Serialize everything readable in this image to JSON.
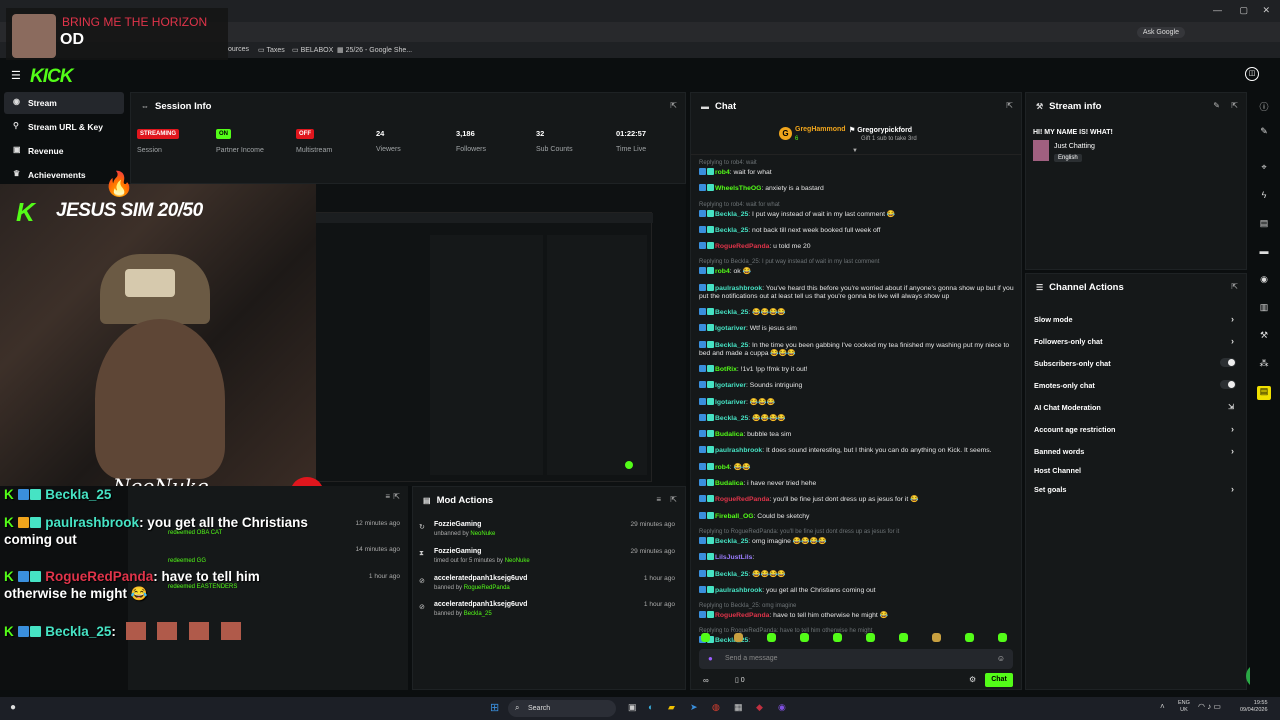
{
  "browser": {
    "song_title": "BRING ME THE HORIZON",
    "song_sub": "OD",
    "bookmarks": [
      "ources",
      "Taxes",
      "BELABOX",
      "25/26 - Google She..."
    ],
    "ask_google": "Ask Google"
  },
  "sidebar": {
    "items": [
      {
        "label": "Stream",
        "icon": "broadcast-icon"
      },
      {
        "label": "Stream URL & Key",
        "icon": "key-icon"
      },
      {
        "label": "Revenue",
        "icon": "dollar-icon"
      },
      {
        "label": "Achievements",
        "icon": "trophy-icon"
      }
    ]
  },
  "session": {
    "title": "Session Info",
    "stats": [
      {
        "value": "STREAMING",
        "label": "Session",
        "kind": "badge",
        "color": "#e0161d"
      },
      {
        "value": "ON",
        "label": "Partner Income",
        "kind": "badge",
        "color": "#53fc18"
      },
      {
        "value": "OFF",
        "label": "Multistream",
        "kind": "badge",
        "color": "#e0161d"
      },
      {
        "value": "24",
        "label": "Viewers",
        "kind": "text"
      },
      {
        "value": "3,186",
        "label": "Followers",
        "kind": "text"
      },
      {
        "value": "32",
        "label": "Sub Counts",
        "kind": "text"
      },
      {
        "value": "01:22:57",
        "label": "Time Live",
        "kind": "text"
      }
    ]
  },
  "overlay": {
    "goal": "JESUS SIM 20/50",
    "signature": "NeoNuke",
    "chat": [
      {
        "user": "Beckla_25",
        "user_color": "#46e3c4",
        "text": ""
      },
      {
        "user": "paulrashbrook",
        "user_color": "#46e3c4",
        "text": ": you get all the Christians coming out"
      },
      {
        "user": "RogueRedPanda",
        "user_color": "#e0344a",
        "text": ": have to tell him otherwise he might 😂"
      },
      {
        "user": "Beckla_25",
        "user_color": "#46e3c4",
        "text": ":"
      }
    ],
    "redeems": [
      {
        "text": "redeemed OBA CAT",
        "time": "12 minutes ago"
      },
      {
        "text": "redeemed GG",
        "time": "14 minutes ago"
      },
      {
        "text": "redeemed EASTENDERS",
        "time": "1 hour ago"
      }
    ]
  },
  "mod_actions": {
    "title": "Mod Actions",
    "items": [
      {
        "user": "FozzieGaming",
        "detail_prefix": "unbanned by ",
        "by": "NeoNuke",
        "time": "29 minutes ago",
        "icon": "unban-icon"
      },
      {
        "user": "FozzieGaming",
        "detail_prefix": "timed out for 5 minutes by ",
        "by": "NeoNuke",
        "time": "29 minutes ago",
        "icon": "hourglass-icon"
      },
      {
        "user": "acceleratedpanh1ksejg6uvd",
        "detail_prefix": "banned by ",
        "by": "RogueRedPanda",
        "time": "1 hour ago",
        "icon": "ban-icon"
      },
      {
        "user": "acceleratedpanh1ksejg6uvd",
        "detail_prefix": "banned by ",
        "by": "Beckla_25",
        "time": "1 hour ago",
        "icon": "ban-icon"
      }
    ]
  },
  "chat": {
    "title": "Chat",
    "pinned_gifter": "GregHammond",
    "pinned_gifter_sub": "6",
    "pinned_gift_to": "Gregorypickford",
    "pinned_note": "Gift 1 sub to take 3rd",
    "messages": [
      {
        "user": "rob4",
        "color": "#53fc18",
        "text": ": wait for what",
        "reply": "Replying to rob4: wait"
      },
      {
        "user": "WheelsTheOG",
        "color": "#53fc18",
        "text": ": anxiety is a bastard",
        "reply": ""
      },
      {
        "user": "Beckla_25",
        "color": "#46e3c4",
        "text": ": I put way instead of wait in my last comment 😂",
        "reply": "Replying to rob4: wait for what"
      },
      {
        "user": "Beckla_25",
        "color": "#46e3c4",
        "text": ": not back till next week booked full week off",
        "reply": ""
      },
      {
        "user": "RogueRedPanda",
        "color": "#e0344a",
        "text": ": u told me 20",
        "reply": ""
      },
      {
        "user": "rob4",
        "color": "#53fc18",
        "text": ": ok 😂",
        "reply": "Replying to Beckla_25: I put way instead of wait in my last comment"
      },
      {
        "user": "paulrashbrook",
        "color": "#46e3c4",
        "text": ": You've heard this before you're worried about if anyone's gonna show up but if you put the notifications out at least tell us that you're gonna be live will always show up",
        "reply": ""
      },
      {
        "user": "Beckla_25",
        "color": "#46e3c4",
        "text": ": 😂😂😂😂",
        "reply": ""
      },
      {
        "user": "Igotariver",
        "color": "#46e3c4",
        "text": ": Wtf is jesus sim",
        "reply": ""
      },
      {
        "user": "Beckla_25",
        "color": "#46e3c4",
        "text": ": In the time you been gabbing I've cooked my tea finished my washing put my niece to bed and made a cuppa 😂😂😂",
        "reply": ""
      },
      {
        "user": "BotRix",
        "color": "#53fc18",
        "text": ": !1v1 !pp !fmk try it out!",
        "reply": ""
      },
      {
        "user": "Igotariver",
        "color": "#46e3c4",
        "text": ": Sounds intriguing",
        "reply": ""
      },
      {
        "user": "Igotariver",
        "color": "#46e3c4",
        "text": ": 😂😂😂",
        "reply": ""
      },
      {
        "user": "Beckla_25",
        "color": "#46e3c4",
        "text": ": 😂😂😂😂",
        "reply": ""
      },
      {
        "user": "Budalica",
        "color": "#53fc18",
        "text": ": bubble tea sim",
        "reply": ""
      },
      {
        "user": "paulrashbrook",
        "color": "#46e3c4",
        "text": ": It does sound interesting, but I think you can do anything on Kick. It seems.",
        "reply": ""
      },
      {
        "user": "rob4",
        "color": "#53fc18",
        "text": ": 😂😂",
        "reply": ""
      },
      {
        "user": "Budalica",
        "color": "#53fc18",
        "text": ": i have never tried hehe",
        "reply": ""
      },
      {
        "user": "RogueRedPanda",
        "color": "#e0344a",
        "text": ": you'll be fine just dont dress up as jesus for it 😂",
        "reply": ""
      },
      {
        "user": "Fireball_OG",
        "color": "#53fc18",
        "text": ": Could be sketchy",
        "reply": ""
      },
      {
        "user": "Beckla_25",
        "color": "#46e3c4",
        "text": ": omg imagine 😂😂😂😂",
        "reply": "Replying to RogueRedPanda: you'll be fine just dont dress up as jesus for it"
      },
      {
        "user": "LilsJustLils",
        "color": "#9b7dff",
        "text": ":",
        "reply": ""
      },
      {
        "user": "Beckla_25",
        "color": "#46e3c4",
        "text": ": 😂😂😂😂",
        "reply": ""
      },
      {
        "user": "paulrashbrook",
        "color": "#46e3c4",
        "text": ": you get all the Christians coming out",
        "reply": ""
      },
      {
        "user": "RogueRedPanda",
        "color": "#e0344a",
        "text": ": have to tell him otherwise he might 😂",
        "reply": "Replying to Beckla_25: omg imagine"
      },
      {
        "user": "Beckla_25",
        "color": "#46e3c4",
        "text": ":",
        "reply": "Replying to RogueRedPanda: have to tell him otherwise he might"
      }
    ],
    "input_placeholder": "Send a message",
    "viewer_count": "0",
    "send_label": "Chat"
  },
  "stream_info": {
    "title": "Stream info",
    "stream_title": "HI! MY NAME IS! WHAT!",
    "category": "Just Chatting",
    "language": "English"
  },
  "channel_actions": {
    "title": "Channel Actions",
    "items": [
      {
        "label": "Slow mode",
        "control": "chevron"
      },
      {
        "label": "Followers-only chat",
        "control": "chevron"
      },
      {
        "label": "Subscribers-only chat",
        "control": "toggle"
      },
      {
        "label": "Emotes-only chat",
        "control": "toggle"
      },
      {
        "label": "AI Chat Moderation",
        "control": "external"
      },
      {
        "label": "Account age restriction",
        "control": "chevron"
      },
      {
        "label": "Banned words",
        "control": "chevron"
      },
      {
        "label": "Host Channel",
        "control": "none"
      },
      {
        "label": "Set goals",
        "control": "chevron"
      }
    ]
  },
  "taskbar": {
    "search": "Search",
    "lang": "ENG",
    "region": "UK",
    "time": "19:55",
    "date": "09/04/2026"
  },
  "colors": {
    "brand": "#53fc18",
    "panel": "#151819",
    "bg": "#0b0e0f"
  }
}
